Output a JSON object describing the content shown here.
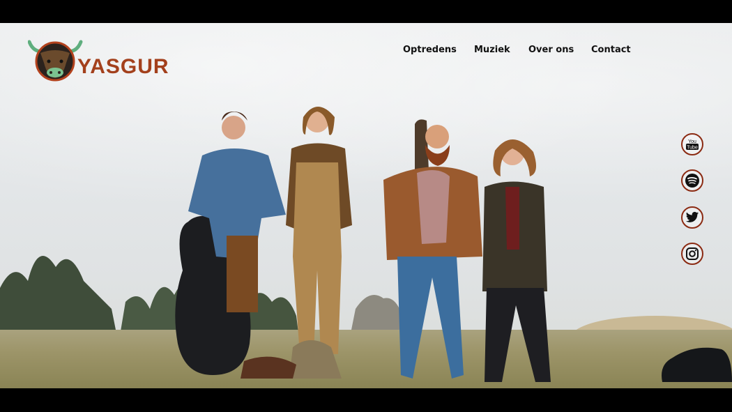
{
  "brand": {
    "name": "YASGUR",
    "logo_icon": "bull-head-icon",
    "color": "#a3401c"
  },
  "nav": {
    "items": [
      {
        "label": "Optredens"
      },
      {
        "label": "Muziek"
      },
      {
        "label": "Over ons"
      },
      {
        "label": "Contact"
      }
    ]
  },
  "social": [
    {
      "name": "youtube-icon",
      "label": "You Tube"
    },
    {
      "name": "spotify-icon"
    },
    {
      "name": "twitter-icon"
    },
    {
      "name": "instagram-icon"
    }
  ],
  "colors": {
    "accent": "#8b2a12",
    "nav_text": "#111111"
  }
}
